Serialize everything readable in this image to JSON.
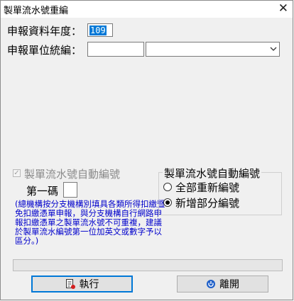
{
  "window": {
    "title": "製單流水號重編",
    "close_glyph": "✕"
  },
  "form": {
    "year_label": "申報資料年度：",
    "year_value": "109",
    "unit_label": "申報單位統編：",
    "unit_value": "",
    "unit_select_value": ""
  },
  "auto_numbering": {
    "checkbox_label": "製單流水號自動編號",
    "checked": true,
    "enabled": false,
    "first_code_label": "第一碼",
    "first_code_value": "",
    "note": "(總機構按分支機構別填具各類所得扣繳暨免扣繳憑單申報，與分支機構自行網路申報扣繳憑單之製單流水號不可重複，建議於製單流水編號第一位加英文或數字予以區分。)"
  },
  "renumber_mode": {
    "group_title": "製單流水號自動編號",
    "options": [
      {
        "label": "全部重新編號",
        "selected": false
      },
      {
        "label": "新增部分編號",
        "selected": true
      }
    ]
  },
  "progress": {
    "value": 0
  },
  "buttons": {
    "execute_label": "執行",
    "exit_label": "離開"
  },
  "colors": {
    "note_text": "#0000cc",
    "selection": "#0078d7",
    "default_button_border": "#0078d7"
  }
}
